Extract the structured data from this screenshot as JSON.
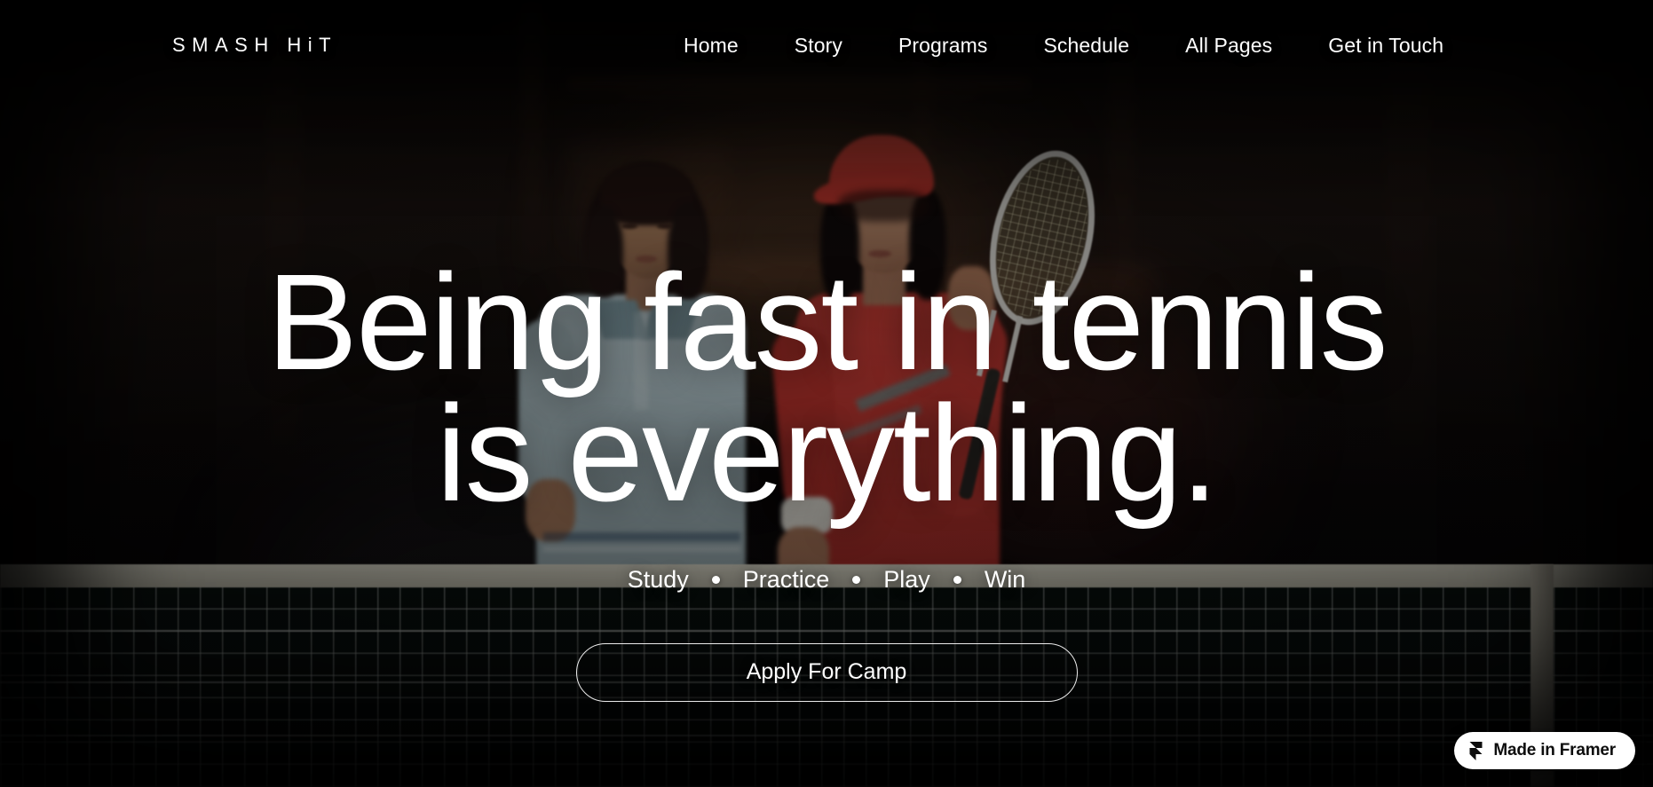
{
  "brand": {
    "logo_text": "SMASH HiT"
  },
  "nav": {
    "items": [
      {
        "label": "Home"
      },
      {
        "label": "Story"
      },
      {
        "label": "Programs"
      },
      {
        "label": "Schedule"
      },
      {
        "label": "All Pages"
      },
      {
        "label": "Get in Touch"
      }
    ]
  },
  "hero": {
    "headline_line1": "Being fast in tennis",
    "headline_line2": "is everything.",
    "tagline": [
      {
        "label": "Study"
      },
      {
        "label": "Practice"
      },
      {
        "label": "Play"
      },
      {
        "label": "Win"
      }
    ],
    "cta_label": "Apply For Camp"
  },
  "badge": {
    "label": "Made in Framer"
  },
  "colors": {
    "background": "#08070a",
    "text": "#ffffff",
    "badge_background": "#ffffff",
    "badge_text": "#0d0d0d",
    "accent_red": "#c23b34",
    "accent_blue": "#b6c8cd"
  }
}
